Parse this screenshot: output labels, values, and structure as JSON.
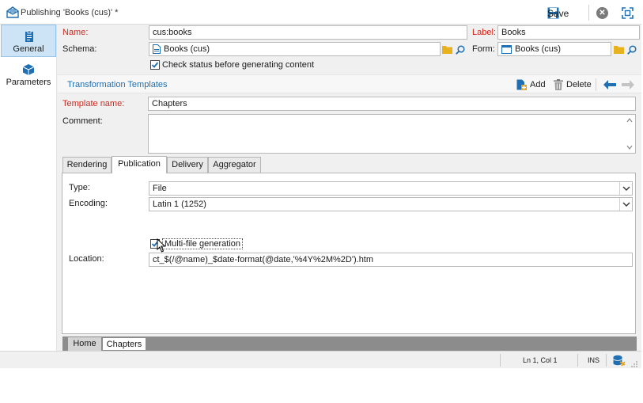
{
  "window": {
    "title": "Publishing 'Books (cus)' *"
  },
  "toolbar": {
    "save_label": "Save"
  },
  "nav": {
    "items": [
      {
        "label": "General",
        "icon": "clipboard-icon"
      },
      {
        "label": "Parameters",
        "icon": "cube-icon"
      }
    ]
  },
  "form": {
    "name_label": "Name:",
    "name_value": "cus:books",
    "label_label": "Label:",
    "label_value": "Books",
    "schema_label": "Schema:",
    "schema_value": "Books (cus)",
    "form_label": "Form:",
    "form_value": "Books (cus)",
    "check_status_label": "Check status before generating content"
  },
  "section": {
    "title": "Transformation Templates",
    "add_label": "Add",
    "delete_label": "Delete"
  },
  "template": {
    "name_label": "Template name:",
    "name_value": "Chapters",
    "comment_label": "Comment:",
    "comment_value": ""
  },
  "tabs": [
    {
      "label": "Rendering"
    },
    {
      "label": "Publication"
    },
    {
      "label": "Delivery"
    },
    {
      "label": "Aggregator"
    }
  ],
  "publication": {
    "type_label": "Type:",
    "type_value": "File",
    "encoding_label": "Encoding:",
    "encoding_value": "Latin 1 (1252)",
    "multifile_label": "Multi-file generation",
    "location_label": "Location:",
    "location_value": "ct_$(/@name)_$date-format(@date,'%4Y%2M%2D').htm"
  },
  "bottom_tabs": [
    {
      "label": "Home"
    },
    {
      "label": "Chapters"
    }
  ],
  "statusbar": {
    "position": "Ln 1, Col 1",
    "mode": "INS"
  },
  "colors": {
    "accent": "#1f6fb2",
    "required": "#d0271d",
    "nav_active": "#cde4f7"
  }
}
